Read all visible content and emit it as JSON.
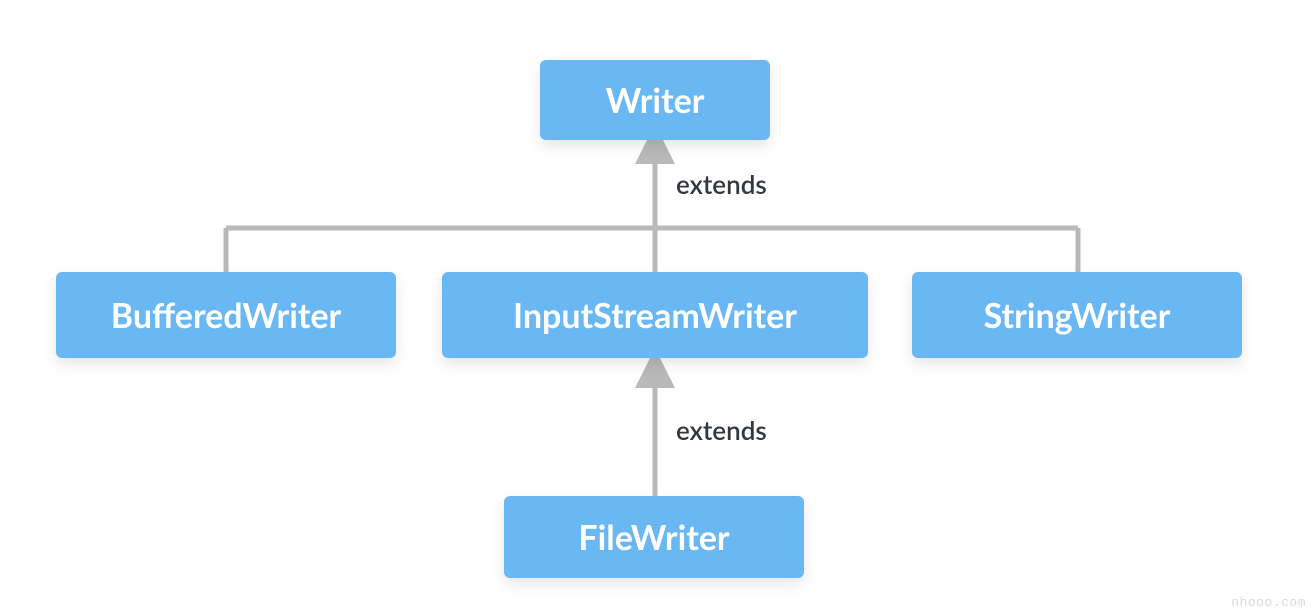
{
  "diagram": {
    "root": {
      "label": "Writer"
    },
    "children": [
      {
        "key": "buffered",
        "label": "BufferedWriter"
      },
      {
        "key": "inputstream",
        "label": "InputStreamWriter"
      },
      {
        "key": "string",
        "label": "StringWriter"
      }
    ],
    "grandchild": {
      "label": "FileWriter"
    },
    "edge_labels": {
      "root_extends": "extends",
      "grandchild_extends": "extends"
    },
    "relation": "extends"
  },
  "colors": {
    "node_bg": "#69b8f4",
    "node_text": "#ffffff",
    "line": "#b9b9b9",
    "label_text": "#34383c"
  },
  "watermark": "nhooo.com"
}
